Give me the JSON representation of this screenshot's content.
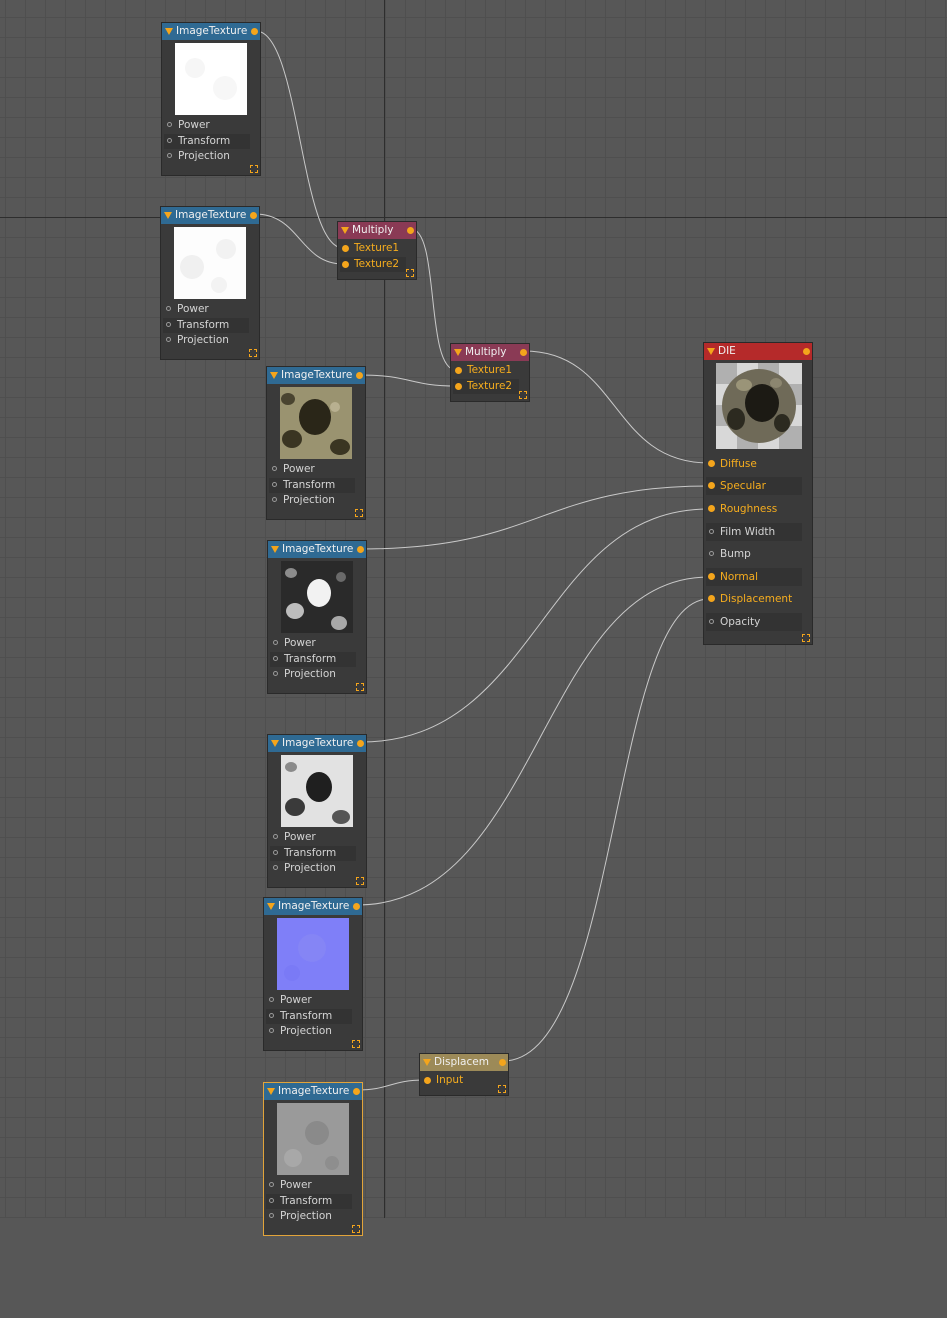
{
  "colors": {
    "background": "#575757",
    "grid": "#4f4f4f",
    "texture_header": "#2f6a93",
    "multiply_header": "#8a3a55",
    "material_header": "#b52a2a",
    "displacement_header": "#9c8a58",
    "port_active": "#f4a51c",
    "selection": "#e2a43a"
  },
  "texture_node": {
    "title": "ImageTexture",
    "inputs": [
      "Power",
      "Transform",
      "Projection"
    ]
  },
  "texture_nodes": [
    {
      "preview": "white-noise",
      "selected": false
    },
    {
      "preview": "white-noise",
      "selected": false
    },
    {
      "preview": "olive-dark-blotches",
      "selected": false
    },
    {
      "preview": "bw-noise",
      "selected": false
    },
    {
      "preview": "light-bw-blotches",
      "selected": false
    },
    {
      "preview": "normal-map-blue",
      "selected": false
    },
    {
      "preview": "grey-noise",
      "selected": true
    }
  ],
  "multiply_node": {
    "title": "Multiply",
    "inputs": [
      "Texture1",
      "Texture2"
    ]
  },
  "material_node": {
    "title": "DIE",
    "preview": "rough-sphere",
    "inputs": [
      {
        "label": "Diffuse",
        "connected": true
      },
      {
        "label": "Specular",
        "connected": true
      },
      {
        "label": "Roughness",
        "connected": true
      },
      {
        "label": "Film Width",
        "connected": false
      },
      {
        "label": "Bump",
        "connected": false
      },
      {
        "label": "Normal",
        "connected": true
      },
      {
        "label": "Displacement",
        "connected": true
      },
      {
        "label": "Opacity",
        "connected": false
      }
    ]
  },
  "displacement_node": {
    "title": "Displacem",
    "inputs": [
      "Input"
    ]
  },
  "icons": {
    "collapse": "collapse-arrow-icon",
    "resize": "resize-handle-icon",
    "port": "port-dot-icon"
  }
}
